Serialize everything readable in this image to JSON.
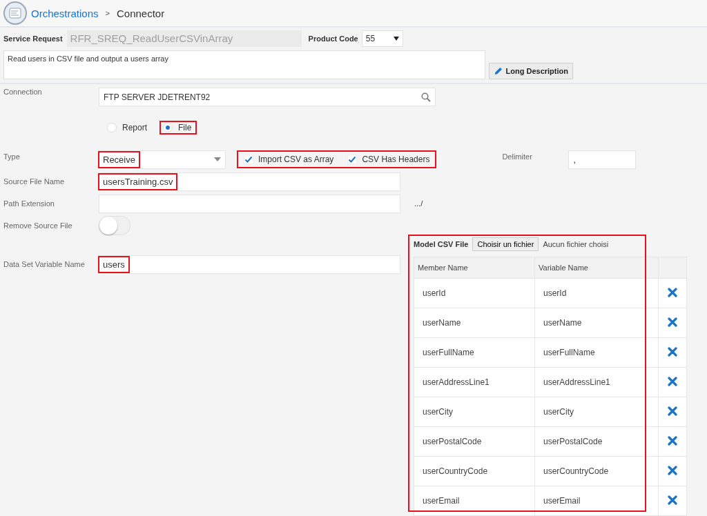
{
  "breadcrumb": {
    "parent": "Orchestrations",
    "separator": ">",
    "current": "Connector"
  },
  "service_request": {
    "label": "Service Request",
    "value": "RFR_SREQ_ReadUserCSVinArray"
  },
  "product_code": {
    "label": "Product Code",
    "value": "55"
  },
  "description": {
    "value": "Read users in CSV file and output a users array"
  },
  "long_description_button": "Long Description",
  "connection": {
    "label": "Connection",
    "value": "FTP SERVER JDETRENT92"
  },
  "source_type": {
    "options": [
      {
        "label": "Report",
        "selected": false,
        "highlighted": false
      },
      {
        "label": "File",
        "selected": true,
        "highlighted": true
      }
    ]
  },
  "type": {
    "label": "Type",
    "value": "Receive",
    "highlighted": true
  },
  "csv_options": {
    "highlighted": true,
    "items": [
      {
        "label": "Import CSV as Array",
        "checked": true
      },
      {
        "label": "CSV Has Headers",
        "checked": true
      }
    ]
  },
  "delimiter": {
    "label": "Delimiter",
    "value": ","
  },
  "source_file_name": {
    "label": "Source File Name",
    "value": "usersTraining.csv",
    "highlighted": true
  },
  "path_extension": {
    "label": "Path Extension",
    "suffix": ".../"
  },
  "remove_source_file": {
    "label": "Remove Source File",
    "on": false
  },
  "data_set_variable_name": {
    "label": "Data Set Variable Name",
    "value": "users",
    "highlighted": true
  },
  "model_csv": {
    "label": "Model CSV File",
    "file_button": "Choisir un fichier",
    "file_status": "Aucun fichier choisi",
    "highlighted": true,
    "table": {
      "columns": [
        "Member Name",
        "Variable Name"
      ],
      "rows": [
        {
          "member": "userId",
          "variable": "userId"
        },
        {
          "member": "userName",
          "variable": "userName"
        },
        {
          "member": "userFullName",
          "variable": "userFullName"
        },
        {
          "member": "userAddressLine1",
          "variable": "userAddressLine1"
        },
        {
          "member": "userCity",
          "variable": "userCity"
        },
        {
          "member": "userPostalCode",
          "variable": "userPostalCode"
        },
        {
          "member": "userCountryCode",
          "variable": "userCountryCode"
        },
        {
          "member": "userEmail",
          "variable": "userEmail"
        }
      ]
    }
  }
}
